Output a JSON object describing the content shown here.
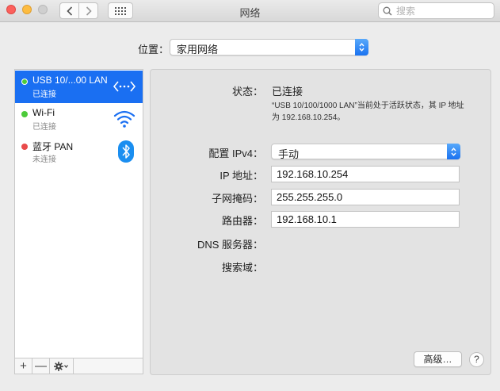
{
  "window": {
    "title": "网络"
  },
  "toolbar": {
    "back_icon": "chevron-left-icon",
    "forward_icon": "chevron-right-icon",
    "grid_icon": "grid-icon",
    "search_placeholder": "搜索"
  },
  "location": {
    "label": "位置：",
    "value": "家用网络"
  },
  "services": [
    {
      "name": "USB 10/...00 LAN",
      "status": "已连接",
      "dot_color": "#4ccb3a",
      "icon": "ethernet-arrows-icon",
      "selected": true
    },
    {
      "name": "Wi-Fi",
      "status": "已连接",
      "dot_color": "#4ccb3a",
      "icon": "wifi-icon",
      "selected": false
    },
    {
      "name": "蓝牙 PAN",
      "status": "未连接",
      "dot_color": "#e94a4a",
      "icon": "bluetooth-icon",
      "selected": false
    }
  ],
  "sidebar_toolbar": {
    "add": "+",
    "remove": "—",
    "gear_icon": "gear-icon"
  },
  "detail": {
    "status_label": "状态：",
    "status_value": "已连接",
    "status_description": "“USB 10/100/1000 LAN”当前处于活跃状态，其 IP 地址为 192.168.10.254。",
    "ipv4_label": "配置 IPv4：",
    "ipv4_value": "手动",
    "ip_label": "IP 地址：",
    "ip_value": "192.168.10.254",
    "subnet_label": "子网掩码：",
    "subnet_value": "255.255.255.0",
    "router_label": "路由器：",
    "router_value": "192.168.10.1",
    "dns_label": "DNS 服务器：",
    "search_domain_label": "搜索域：",
    "advanced_button": "高级…",
    "help_button": "?"
  },
  "colors": {
    "accent": "#1a6ff2",
    "connected": "#4ccb3a",
    "disconnected": "#e94a4a"
  }
}
